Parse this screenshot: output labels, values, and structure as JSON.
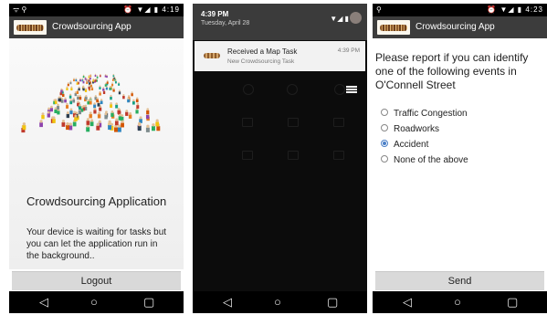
{
  "phone1": {
    "status": {
      "left_icons": "ᯤ ⚲",
      "right_icons": "⏰ ▼◢ ▮",
      "time": "4:19"
    },
    "app_title": "Crowdsourcing App",
    "heading": "Crowdsourcing Application",
    "message": "Your device is waiting for tasks but you can let the application run in the background..",
    "logout_label": "Logout",
    "nav": {
      "back": "◁",
      "home": "○",
      "recent": "▢"
    }
  },
  "phone2": {
    "time": "4:39 PM",
    "date": "Tuesday, April 28",
    "notification": {
      "title": "Received a Map Task",
      "subtitle": "New Crowdsourcing Task",
      "time": "4:39 PM"
    },
    "nav": {
      "back": "◁",
      "home": "○",
      "recent": "▢"
    }
  },
  "phone3": {
    "status": {
      "left_icons": "⚲",
      "right_icons": "⏰ ▼◢ ▮",
      "time": "4:23"
    },
    "app_title": "Crowdsourcing App",
    "question": "Please report if you can identify one of the following events in O'Connell Street",
    "options": [
      {
        "label": "Traffic Congestion",
        "selected": false
      },
      {
        "label": "Roadworks",
        "selected": false
      },
      {
        "label": "Accident",
        "selected": true
      },
      {
        "label": "None of the above",
        "selected": false
      }
    ],
    "send_label": "Send",
    "nav": {
      "back": "◁",
      "home": "○",
      "recent": "▢"
    }
  },
  "colors": {
    "appbar": "#3c3c3c",
    "radio_accent": "#4a7fc7",
    "button_bg": "#d9d9d9"
  }
}
